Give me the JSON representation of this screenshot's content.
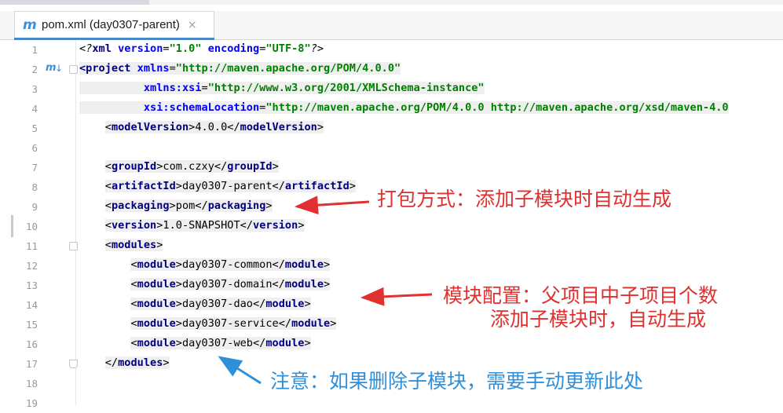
{
  "tab": {
    "icon": "m",
    "title": "pom.xml (day0307-parent)",
    "close": "×",
    "close_icon": "close-icon",
    "maven_icon": "maven-m-icon"
  },
  "lines": [
    {
      "n": "1"
    },
    {
      "n": "2"
    },
    {
      "n": "3"
    },
    {
      "n": "4"
    },
    {
      "n": "5"
    },
    {
      "n": "6"
    },
    {
      "n": "7"
    },
    {
      "n": "8"
    },
    {
      "n": "9"
    },
    {
      "n": "10"
    },
    {
      "n": "11"
    },
    {
      "n": "12"
    },
    {
      "n": "13"
    },
    {
      "n": "14"
    },
    {
      "n": "15"
    },
    {
      "n": "16"
    },
    {
      "n": "17"
    },
    {
      "n": "18"
    },
    {
      "n": "19"
    }
  ],
  "code": {
    "l1": {
      "pi_open": "<?",
      "decl": "xml",
      "a1": "version",
      "v1": "\"1.0\"",
      "a2": "encoding",
      "v2": "\"UTF-8\"",
      "pi_close": "?>"
    },
    "l2": {
      "open": "<project",
      "attr": "xmlns",
      "val": "\"http://maven.apache.org/POM/4.0.0\""
    },
    "l3": {
      "attr": "xmlns:xsi",
      "val": "\"http://www.w3.org/2001/XMLSchema-instance\""
    },
    "l4": {
      "attr": "xsi:schemaLocation",
      "val": "\"http://maven.apache.org/POM/4.0.0 http://maven.apache.org/xsd/maven-4.0"
    },
    "l5": {
      "tag": "modelVersion",
      "value": "4.0.0"
    },
    "l7": {
      "tag": "groupId",
      "value": "com.czxy"
    },
    "l8": {
      "tag": "artifactId",
      "value": "day0307-parent"
    },
    "l9": {
      "tag": "packaging",
      "value": "pom"
    },
    "l10": {
      "tag": "version",
      "value": "1.0-SNAPSHOT"
    },
    "l11": {
      "tag": "modules"
    },
    "modules": [
      {
        "tag": "module",
        "value": "day0307-common"
      },
      {
        "tag": "module",
        "value": "day0307-domain"
      },
      {
        "tag": "module",
        "value": "day0307-dao"
      },
      {
        "tag": "module",
        "value": "day0307-service"
      },
      {
        "tag": "module",
        "value": "day0307-web"
      }
    ],
    "l17": {
      "tag": "modules"
    }
  },
  "annotations": {
    "packaging": "打包方式：添加子模块时自动生成",
    "modules_line1": "模块配置：父项目中子项目个数",
    "modules_line2": "添加子模块时，自动生成",
    "note": "注意：如果删除子模块，需要手动更新此处"
  },
  "colors": {
    "annotation_red": "#e03030",
    "annotation_blue": "#2f8fd8",
    "tag": "#000080",
    "attr": "#0000ff",
    "value": "#008000"
  }
}
